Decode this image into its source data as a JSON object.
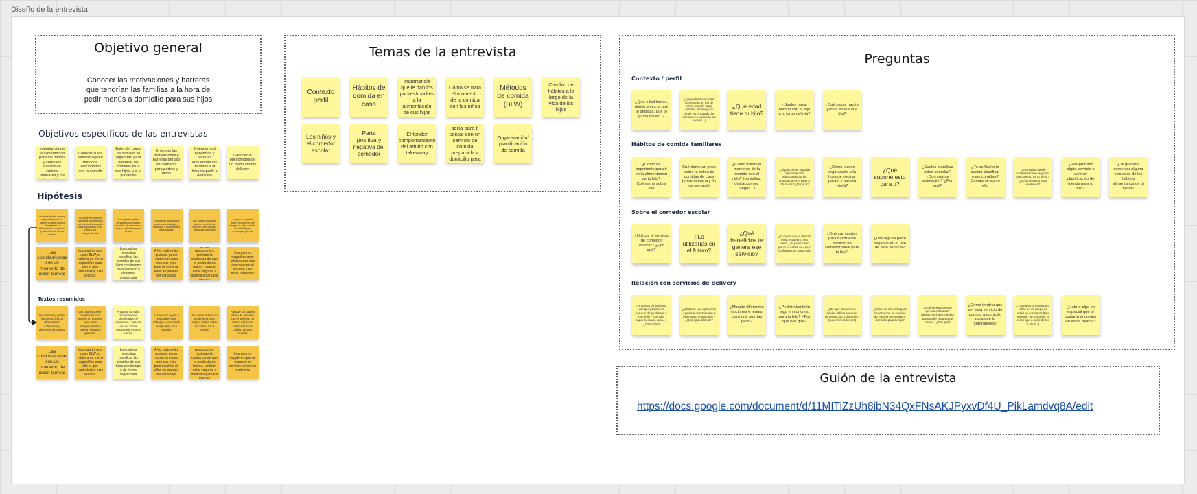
{
  "frame": {
    "title": "Diseño de la entrevista"
  },
  "objetivo": {
    "title": "Objetivo general",
    "text": "Conocer las motivaciones y barreras que tendrían las familias a la hora de pedir menús a domicilio para sus hijos"
  },
  "especificos": {
    "title": "Objetivos específicos de las entrevistas",
    "notes": [
      "Conocer la importancia de la alimentación para los padres y cómo los hábitos de comida familiares y los de sus hijos",
      "Conocer si las familias siguen métodos relacionados con la comida",
      "Entender cómo las familias se organizan para preparar las comidas para sus hijos, y si lo planifican",
      "Entender las motivaciones y barreras del uso del comedor para padres y niños",
      "Entender qué beneficios y barreras encuentran los usuarios a la hora de pedir a domicilio",
      "Conocer la opinión/idea de un menú infantil delivery"
    ]
  },
  "hipotesis": {
    "title": "Hipótesis",
    "row1": [
      "La alimentación es muy importante para los padres y hacen mucho hincapié en la alimentación consciente y alimentos de buena calidad",
      "Los padres no tienen problema que métodos nuevos de alimentación para acompañar a los niños a ser independientes",
      "Los padres suelen preparar las cenas de los niños de antemano y quieren planificar cada detalle",
      "El comedor ayuda a los padres que trabajan y les ayuda a tener tiempo para trabajar",
      "Los padres no dudan sobre el servicio de delivery en sí pero les preocupa la calidad",
      "Aunque los padres tienen recelos de que tenga sus hijos comida de calidad y se preocupan por ello"
    ],
    "row2": [
      "Las comidas/cenas son un momento de unión familiar",
      "Los padres que usan BLW, si hubiera un menú específico para ello sí que contratarían este servicio.",
      "Los padres necesitan planificar las comidas de sus hijos con tiempo de antelación y de forma organizada",
      "A los padres les gustaría poder comer en casa con sus hijos pero muchos de ellos no pueden por el trabajo.",
      "Si los restaurantes tuvieran la confianza de que el producto es bueno, podrían estar seguros a domicilio para los peques",
      "Los padres negativos muy interesados que desconocen el servicio y no tiene confianza"
    ]
  },
  "resumidos": {
    "title": "Textos resumidos",
    "row1": [
      "Las madres y padres valoran mucho la alimentación consciente y alimentos de calidad",
      "Los padres suelen mostrar mucho interés en que sus hijos sean independientes y buscan métodos para ello",
      "Preparar comidas con antelación, planificarlas de antemano y hacerlo de una forma organizada es muy común",
      "El comedor ayuda a los padres que trabajan a tener más tiempo libre para trabajar",
      "Se valora el servicio de delivery pero surgen dudas sobre la calidad de la comida",
      "Aunque los padres están de acuerdo con el delivery, no tienen suficiente confianza en la calidad de este servicio"
    ],
    "row2": [
      "Las comidas/cenas son un momento de unión familiar",
      "Los padres que usan BLW, si hubiera un menú específico para ello sí que contratarían este servicio.",
      "Los padres necesitan planificar las comidas de sus hijos con tiempo y de forma organizada",
      "A los padres les gustaría poder comer en casa con sus hijos pero muchos de ellos no pueden por el trabajo.",
      "Si los restaurantes tuvieran la confianza de que el producto es bueno, podrían estar seguros a domicilio para los peques",
      "Los padres negativos que no conocen el servicio no tienen confianza"
    ]
  },
  "temas": {
    "title": "Temas de la entrevista",
    "notes": [
      "Contexto perfil",
      "Hábitos de comida en casa",
      "Importancia que le dan los padres/madres a la alimentación de sus hijos",
      "Cómo se trata el momento de la comida con los niños",
      "Métodos de comida (BLW)",
      "Cambio de hábitos a lo largo de la vida de los hijos",
      "Los niños y el comedor escolar",
      "Parte positiva y negativa del comedor",
      "Entender comportamiento del adulto con takeaway",
      "Cómo de útil sería para ti contar con un servicio de comida preparada a domicilio para tu hijo",
      "Organización/ planificación de comida"
    ]
  },
  "preguntas": {
    "title": "Preguntas",
    "sections": [
      {
        "title": "Contexto / perfil",
        "notes": [
          "¿Qué edad tienes, dónde vives, a qué te dedicas, qué te gusta hacer...?",
          "¿Me podrías comentar cómo sería un día de rutina para ti? (aquí entraría el trabajo, el comer en el trabajo, las comidas en casa con los peques...)",
          "¿Qué edad tiene tu hijo?",
          "¿Sueles pasar tiempo con tu hijo a lo largo del día?",
          "¿Qué cosas hacéis juntos en el día a día?"
        ]
      },
      {
        "title": "Hábitos de comida familiares",
        "notes": [
          "¿Cómo de importante para ti es la alimentación de tu hijo? Cuéntame sobre ello",
          "Cuéntame un poco sobre la rutina de comidas de casa (entre semana y fin de semana)",
          "¿Cómo tratáis el momento de la comida con el niño? (pantallas, distracciones, juegos...)",
          "¿Sigues o has seguido algún método relacionado con la comida como el BLW o triturados? ¿Por qué?",
          "¿Cómo sueles organizarte a la hora de cocinar para ti y para tu hijo/a?",
          "¿Qué supone esto para ti?",
          "¿Sueles planificar estas comidas? ¿Con cuánta antelación? ¿Por qué?",
          "¿Te es fácil o te cuesta planificar esas comidas? Cuéntame sobre ello",
          "¿Esta rutina ha ido cambiando a lo largo del crecimiento de tu hijo/a? ¿Cómo ha sido esta evolución?",
          "¿Has probado algún servicio o web de planificación de menús para tu hijo?",
          "¿Te gustaría comentar alguna otra cosa de los hábitos alimentarios de tu hijo/a?"
        ]
      },
      {
        "title": "Sobre el comedor escolar",
        "notes": [
          "¿Utilizas el servicio de comedor escolar? ¿Por qué?",
          "¿Lo utilizarías en el futuro?",
          "¿Qué beneficios te genera ese servicio?",
          "¿El menú que le ofrecen en la escuela lo ves bien? ¿Te parece a lo que tú le darías en casa? Cuéntame un poco más",
          "¿Qué cambiarías para hacer este servicio de comedor ideal para tu hijo?",
          "¿Ves alguna parte negativa en el uso de este servicio?"
        ]
      },
      {
        "title": "Relación con servicios de delivery",
        "notes": [
          "¿Y acerca de la última vez que pediste un servicio de productos a domicilio? (comida, supermercado, ropa...) ¿Cómo fue?",
          "¿Utilizaste una aplicación o pediste directamente a la tienda o restaurante? ¿Qué App utilizaste?",
          "¿Miraste diferentes opciones o tenías claro qué querías pedir?",
          "¿Pediste también algo en concreto para tu hijo? ¿Por qué o el qué?",
          "¿En qué situaciones sueles utilizar servicios de productos a domicilio? (supermercados etc)",
          "¿Cómo de útil sería para ti contar con un servicio de comida preparada a domicilio para tu hijo?",
          "¿Qué sensaciones te genera esta idea? (Miedo, rechazo, alegría para poder organizarte mejor...) ¿Por qué?",
          "¿Cómo tendría que ser esta servicio de comida a domicilio para que lo contratases?",
          "¿Esta idea te gusta para niños en un rango de edad en concreto? (Por ejemplo, de 2-5 años, o crees que a partir de los 6 años...)",
          "¿Habría algo en especial que te gustaría encontrar en estos menús?"
        ]
      }
    ]
  },
  "guion": {
    "title": "Guión de la entrevista",
    "url": "https://docs.google.com/document/d/11MITiZzUh8ibN34QxFNsAKJPyxvDf4U_PikLamdvq8A/edit"
  },
  "colors": {
    "note_light": "#fff79c",
    "note_dark": "#f4c546",
    "link": "#1a4fa8"
  }
}
